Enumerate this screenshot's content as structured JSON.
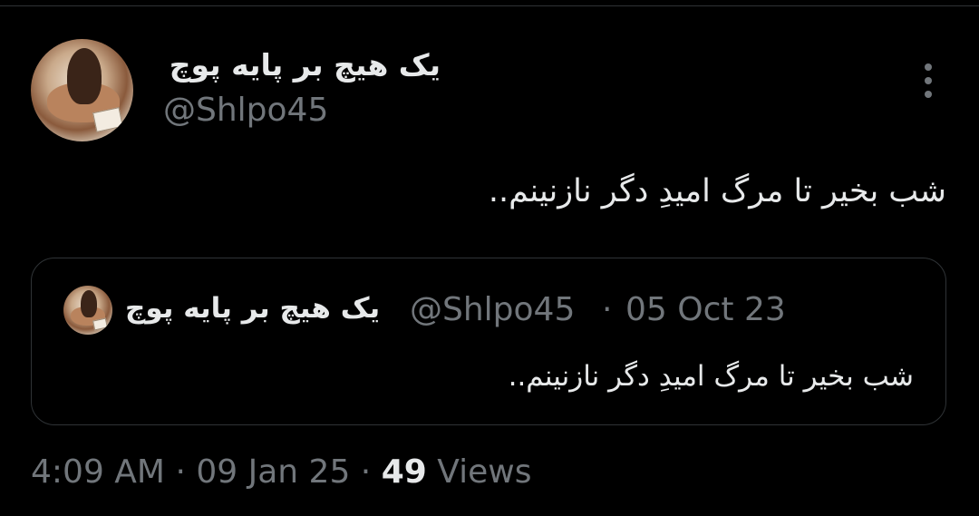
{
  "tweet": {
    "author": {
      "display_name": "یک هیچ بر پایه پوچ",
      "handle": "@Shlpo45"
    },
    "text": "شب بخیر تا مرگ امیدِ دگر نازنینم..",
    "quoted": {
      "display_name": "یک هیچ بر پایه پوچ",
      "handle": "@Shlpo45",
      "separator": "·",
      "date": "05 Oct 23",
      "text": "شب بخیر تا مرگ امیدِ دگر نازنینم.."
    },
    "meta": {
      "time": "4:09 AM",
      "separator": "·",
      "date": "09 Jan 25",
      "views_count": "49",
      "views_label": "Views"
    }
  },
  "icons": {
    "more": "more-vertical-icon"
  },
  "colors": {
    "background": "#000000",
    "primary_text": "#e7e9ea",
    "secondary_text": "#71767b",
    "border": "#2f3336"
  }
}
